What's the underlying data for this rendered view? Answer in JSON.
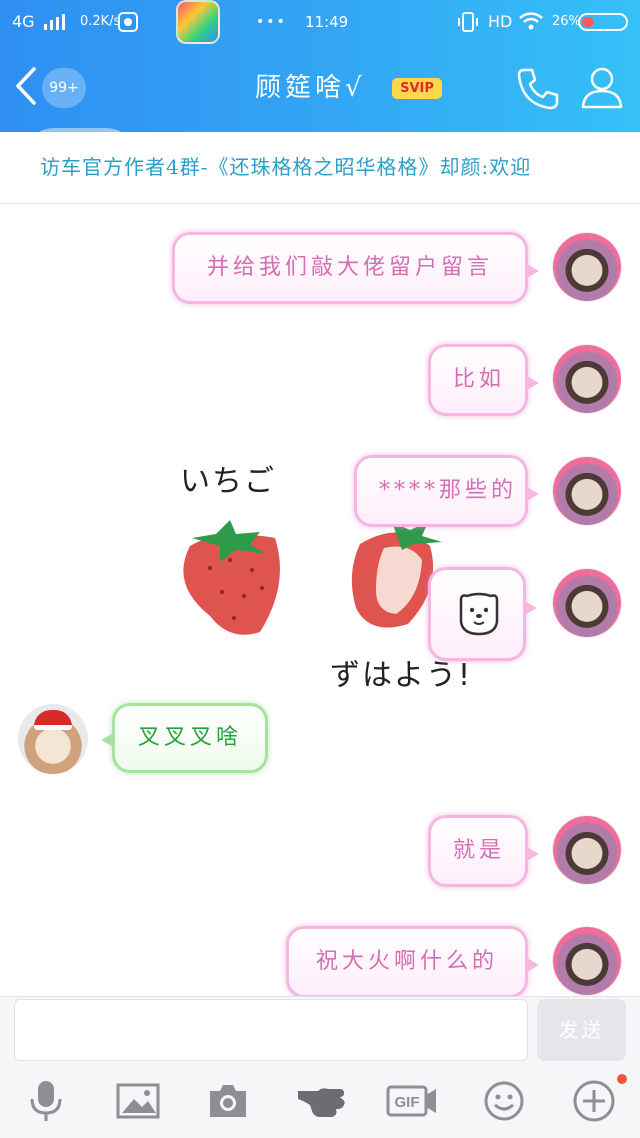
{
  "status_bar": {
    "network": "4G",
    "speed": "0.2K/s",
    "time": "11:49",
    "dots": "•••",
    "hd": "HD",
    "battery": "26%"
  },
  "header": {
    "unread_count": "99+",
    "title": "顾筵啥√",
    "svip": "SVIP"
  },
  "notice": {
    "text": "访车官方作者4群-《还珠格格之昭华格格》却颜:欢迎"
  },
  "sticker": {
    "top_text": "いちご",
    "bottom_text": "ずはよう!"
  },
  "messages": [
    {
      "side": "right",
      "text": "并给我们敲大佬留户留言"
    },
    {
      "side": "right",
      "text": "比如"
    },
    {
      "side": "right",
      "text": "****那些的"
    },
    {
      "side": "right",
      "text": "bear-emoji"
    },
    {
      "side": "left",
      "text": "叉叉叉啥"
    },
    {
      "side": "right",
      "text": "就是"
    },
    {
      "side": "right",
      "text": "祝大火啊什么的"
    }
  ],
  "input": {
    "value": "",
    "send_label": "发送"
  },
  "toolbar": {
    "gif": "GIF"
  },
  "colors": {
    "header_start": "#2f8ff2",
    "header_end": "#35c1f7",
    "right_bubble_text": "#d46fb4",
    "left_bubble_text": "#27a23a",
    "notice_text": "#2aa0c8",
    "notification_dot": "#f2553f"
  }
}
